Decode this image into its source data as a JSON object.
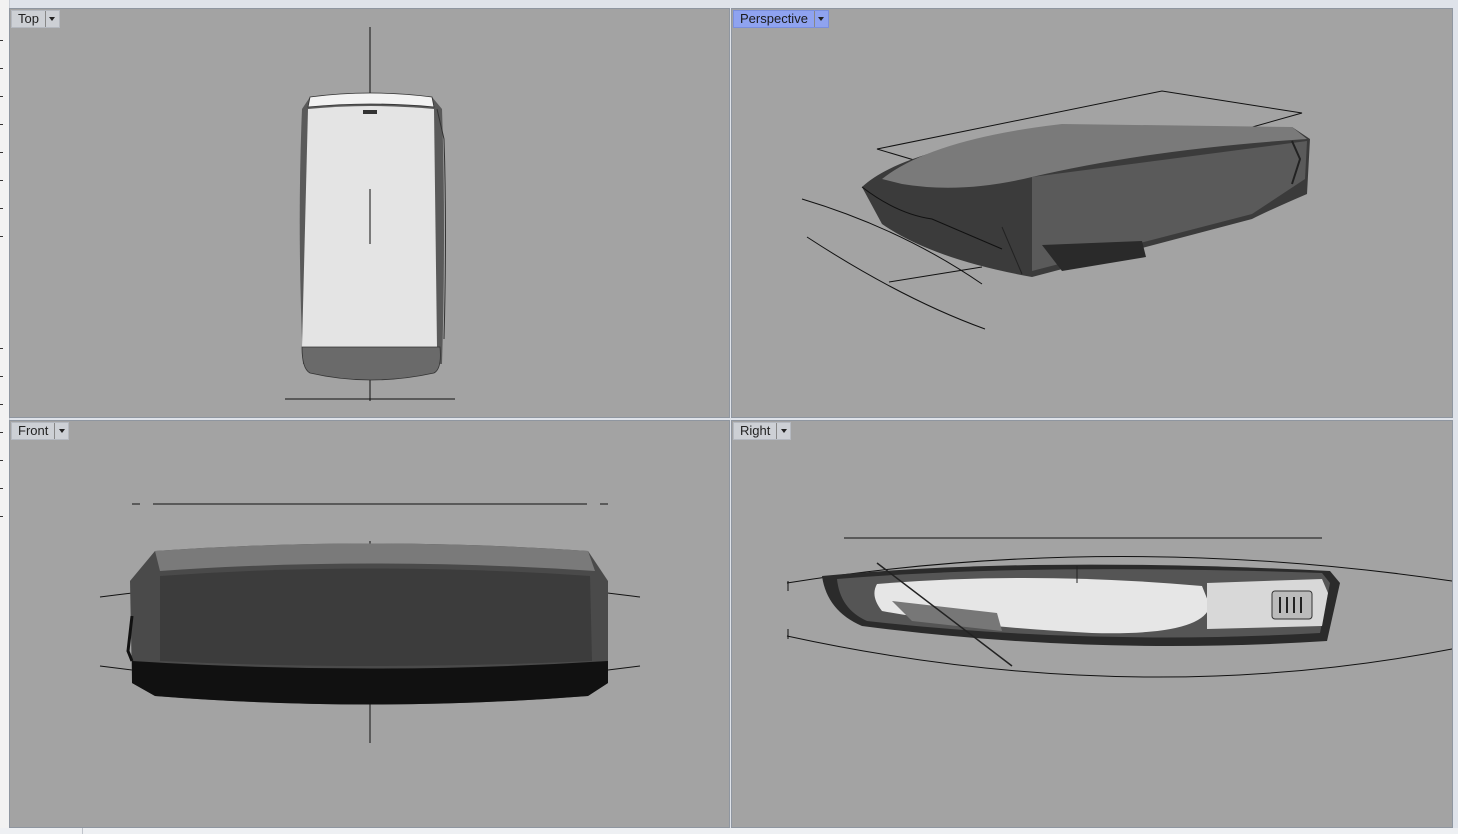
{
  "viewports": {
    "top": {
      "label": "Top"
    },
    "perspective": {
      "label": "Perspective"
    },
    "front": {
      "label": "Front"
    },
    "right": {
      "label": "Right"
    }
  },
  "colors": {
    "viewport_bg": "#a3a3a3",
    "active_tab": "#8fa3f0",
    "shell_dark": "#3a3a3a",
    "shell_light": "#e6e6e6"
  }
}
